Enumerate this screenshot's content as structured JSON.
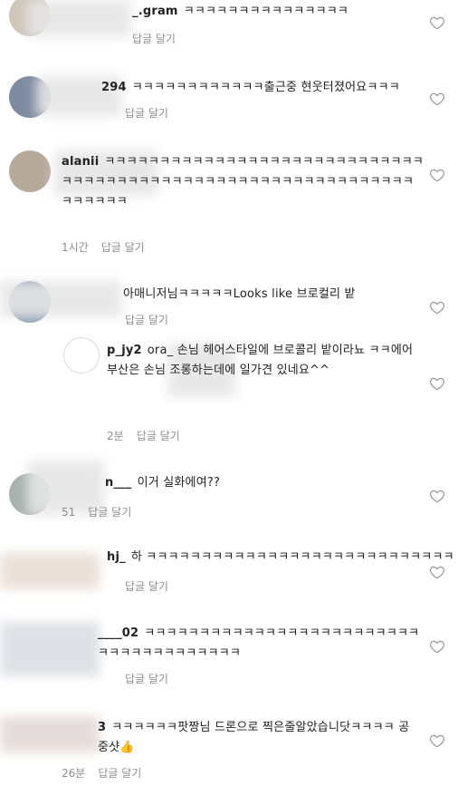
{
  "comments": [
    {
      "user": "_.gram",
      "text": "ㅋㅋㅋㅋㅋㅋㅋㅋㅋㅋㅋㅋㅋㅋㅋ",
      "time": "",
      "reply": "답글 달기"
    },
    {
      "user": "294",
      "text": "ㅋㅋㅋㅋㅋㅋㅋㅋㅋㅋㅋㅋ출근중 현웃터졌어요ㅋㅋㅋ",
      "time": "",
      "reply": "답글 달기"
    },
    {
      "user": "alanii",
      "text": "ㅋㅋㅋㅋㅋㅋㅋㅋㅋㅋㅋㅋㅋㅋㅋㅋㅋㅋㅋㅋㅋㅋㅋㅋㅋㅋㅋㅋㅋㅋㅋㅋㅋㅋㅋㅋㅋㅋㅋㅋㅋㅋㅋㅋㅋㅋㅋㅋㅋㅋㅋㅋㅋㅋㅋㅋㅋㅋㅋㅋㅋㅋㅋㅋㅋㅋㅋ",
      "time": "1시간",
      "reply": "답글 달기"
    },
    {
      "user": "",
      "text": "아매니저님ㅋㅋㅋㅋㅋLooks like 브로컬리 밭",
      "time": "",
      "reply": "답글 달기"
    },
    {
      "user": "p_jy2",
      "text": "ora_ 손님 헤어스타일에 브로콜리 밭이라뇨 ㅋㅋ에어부산은 손님 조롱하는데에 일가견 있네요^^",
      "time": "2분",
      "reply": "답글 달기"
    },
    {
      "user": "n___",
      "text": "이거 실화에여??",
      "time": "51",
      "reply": "답글 달기"
    },
    {
      "user": "hj_",
      "text": "하 ㅋㅋㅋㅋㅋㅋㅋㅋㅋㅋㅋㅋㅋㅋㅋㅋㅋㅋㅋㅋㅋㅋㅋㅋㅋㅋㅋㅋ",
      "time": "",
      "reply": "답글 달기"
    },
    {
      "user": "____02",
      "text": "ㅋㅋㅋㅋㅋㅋㅋㅋㅋㅋㅋㅋㅋㅋㅋㅋㅋㅋㅋㅋㅋㅋㅋㅋㅋㅋㅋㅋㅋㅋㅋㅋㅋㅋㅋㅋㅋㅋ",
      "time": "",
      "reply": "답글 달기"
    },
    {
      "user": "3",
      "text": "ㅋㅋㅋㅋㅋㅋ팟짱님 드론으로 찍은줄알았습니닷ㅋㅋㅋㅋ 공중샷👍",
      "time": "26분",
      "reply": "답글 달기"
    }
  ]
}
